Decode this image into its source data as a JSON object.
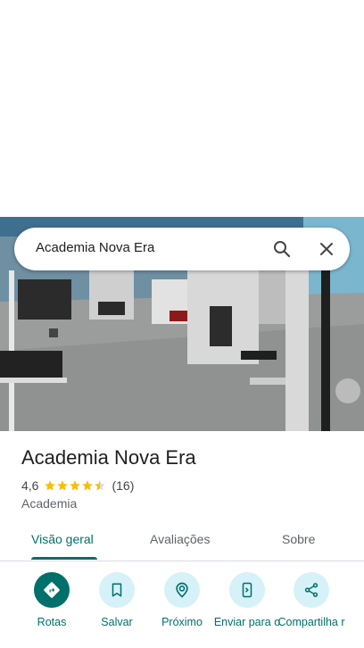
{
  "search": {
    "query": "Academia Nova Era"
  },
  "place": {
    "name": "Academia Nova Era",
    "rating": "4,6",
    "stars": 4.5,
    "reviews": "(16)",
    "category": "Academia"
  },
  "tabs": [
    {
      "label": "Visão geral",
      "active": true
    },
    {
      "label": "Avaliações",
      "active": false
    },
    {
      "label": "Sobre",
      "active": false
    }
  ],
  "actions": [
    {
      "label": "Rotas",
      "icon": "directions-icon"
    },
    {
      "label": "Salvar",
      "icon": "bookmark-icon"
    },
    {
      "label": "Próximo",
      "icon": "nearby-icon"
    },
    {
      "label": "Enviar para o",
      "icon": "send-to-phone-icon"
    },
    {
      "label": "Compartilha r",
      "icon": "share-icon"
    }
  ],
  "colors": {
    "accent": "#00706b",
    "action_bg": "#d6f1f8",
    "star": "#fbbc04"
  }
}
